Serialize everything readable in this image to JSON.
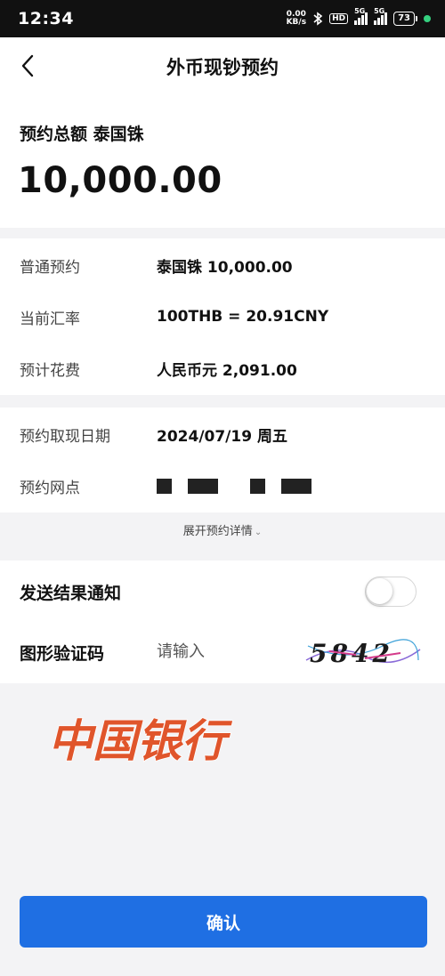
{
  "status_bar": {
    "time": "12:34",
    "net_speed_value": "0.00",
    "net_speed_unit": "KB/s",
    "hd_badge": "HD",
    "sim1_label": "5G",
    "sim2_label": "5G",
    "battery": "73",
    "icons": [
      "bluetooth-icon",
      "signal-icon",
      "battery-icon",
      "notification-dot-icon"
    ]
  },
  "header": {
    "title": "外币现钞预约",
    "back_icon": "chevron-left-icon"
  },
  "total": {
    "label": "预约总额 泰国铢",
    "amount": "10,000.00"
  },
  "details": [
    {
      "label": "普通预约",
      "value": "泰国铢 10,000.00"
    },
    {
      "label": "当前汇率",
      "value": "100THB = 20.91CNY"
    },
    {
      "label": "预计花费",
      "value": "人民币元 2,091.00"
    }
  ],
  "pickup": {
    "date_label": "预约取现日期",
    "date_value": "2024/07/19 周五",
    "branch_label": "预约网点"
  },
  "expand_link": "展开预约详情",
  "settings": {
    "notify_label": "发送结果通知",
    "notify_on": false,
    "captcha_label": "图形验证码",
    "captcha_placeholder": "请输入",
    "captcha_code": "5842"
  },
  "watermark": "中国银行",
  "confirm_label": "确认",
  "colors": {
    "primary": "#1f6fe3",
    "background": "#f3f3f5",
    "watermark": "#e0552b"
  }
}
